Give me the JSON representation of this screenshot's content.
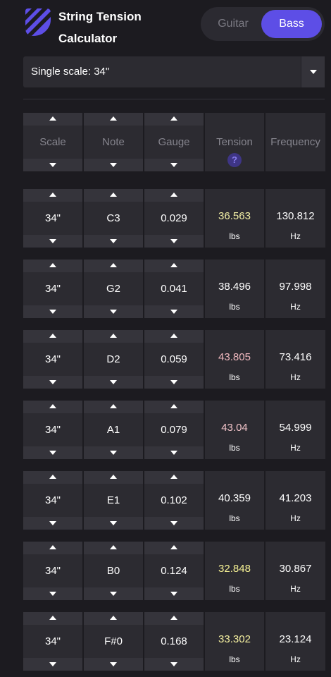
{
  "app": {
    "title_line1": "String Tension",
    "title_line2": "Calculator",
    "toggle": {
      "guitar": "Guitar",
      "bass": "Bass",
      "selected": "Bass"
    },
    "accent": "#5d4ee6"
  },
  "scale_select": {
    "value": "Single scale: 34\""
  },
  "columns": {
    "scale": "Scale",
    "note": "Note",
    "gauge": "Gauge",
    "tension": "Tension",
    "frequency": "Frequency",
    "help": "?"
  },
  "strings": [
    {
      "scale": "34\"",
      "note": "C3",
      "gauge": "0.029",
      "tension": "36.563",
      "tension_unit": "lbs",
      "frequency": "130.812",
      "frequency_unit": "Hz",
      "tension_color": "#f3f0a6"
    },
    {
      "scale": "34\"",
      "note": "G2",
      "gauge": "0.041",
      "tension": "38.496",
      "tension_unit": "lbs",
      "frequency": "97.998",
      "frequency_unit": "Hz",
      "tension_color": "#ffffff"
    },
    {
      "scale": "34\"",
      "note": "D2",
      "gauge": "0.059",
      "tension": "43.805",
      "tension_unit": "lbs",
      "frequency": "73.416",
      "frequency_unit": "Hz",
      "tension_color": "#f1b9bf"
    },
    {
      "scale": "34\"",
      "note": "A1",
      "gauge": "0.079",
      "tension": "43.04",
      "tension_unit": "lbs",
      "frequency": "54.999",
      "frequency_unit": "Hz",
      "tension_color": "#f1c3c8"
    },
    {
      "scale": "34\"",
      "note": "E1",
      "gauge": "0.102",
      "tension": "40.359",
      "tension_unit": "lbs",
      "frequency": "41.203",
      "frequency_unit": "Hz",
      "tension_color": "#ffffff"
    },
    {
      "scale": "34\"",
      "note": "B0",
      "gauge": "0.124",
      "tension": "32.848",
      "tension_unit": "lbs",
      "frequency": "30.867",
      "frequency_unit": "Hz",
      "tension_color": "#f7f294"
    },
    {
      "scale": "34\"",
      "note": "F#0",
      "gauge": "0.168",
      "tension": "33.302",
      "tension_unit": "lbs",
      "frequency": "23.124",
      "frequency_unit": "Hz",
      "tension_color": "#f5f0a0"
    }
  ]
}
